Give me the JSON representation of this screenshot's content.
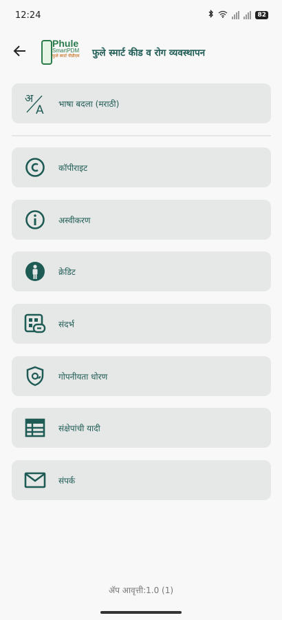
{
  "status_bar": {
    "time": "12:24",
    "battery": "82"
  },
  "header": {
    "title": "फुले स्मार्ट कीड व रोग व्यवस्थापन",
    "logo_main": "Phule",
    "logo_sub": "SmartPDM",
    "logo_tag": "फुले स्मार्ट पीडीएम"
  },
  "menu": {
    "language": "भाषा बदला (मराठी)",
    "items": [
      {
        "label": "कॉपीराइट",
        "icon": "copyright-icon"
      },
      {
        "label": "अस्वीकरण",
        "icon": "info-icon"
      },
      {
        "label": "क्रेडिट",
        "icon": "person-icon"
      },
      {
        "label": "संदर्भ",
        "icon": "references-icon"
      },
      {
        "label": "गोपनीयता धोरण",
        "icon": "privacy-shield-icon"
      },
      {
        "label": "संक्षेपांची यादी",
        "icon": "table-icon"
      },
      {
        "label": "संपर्क",
        "icon": "mail-icon"
      }
    ]
  },
  "footer": {
    "version": "ॲप आवृत्ती:1.0 (1)"
  },
  "colors": {
    "accent": "#1f5b55",
    "card": "#e6e8e7",
    "background": "#f7f8f7"
  }
}
